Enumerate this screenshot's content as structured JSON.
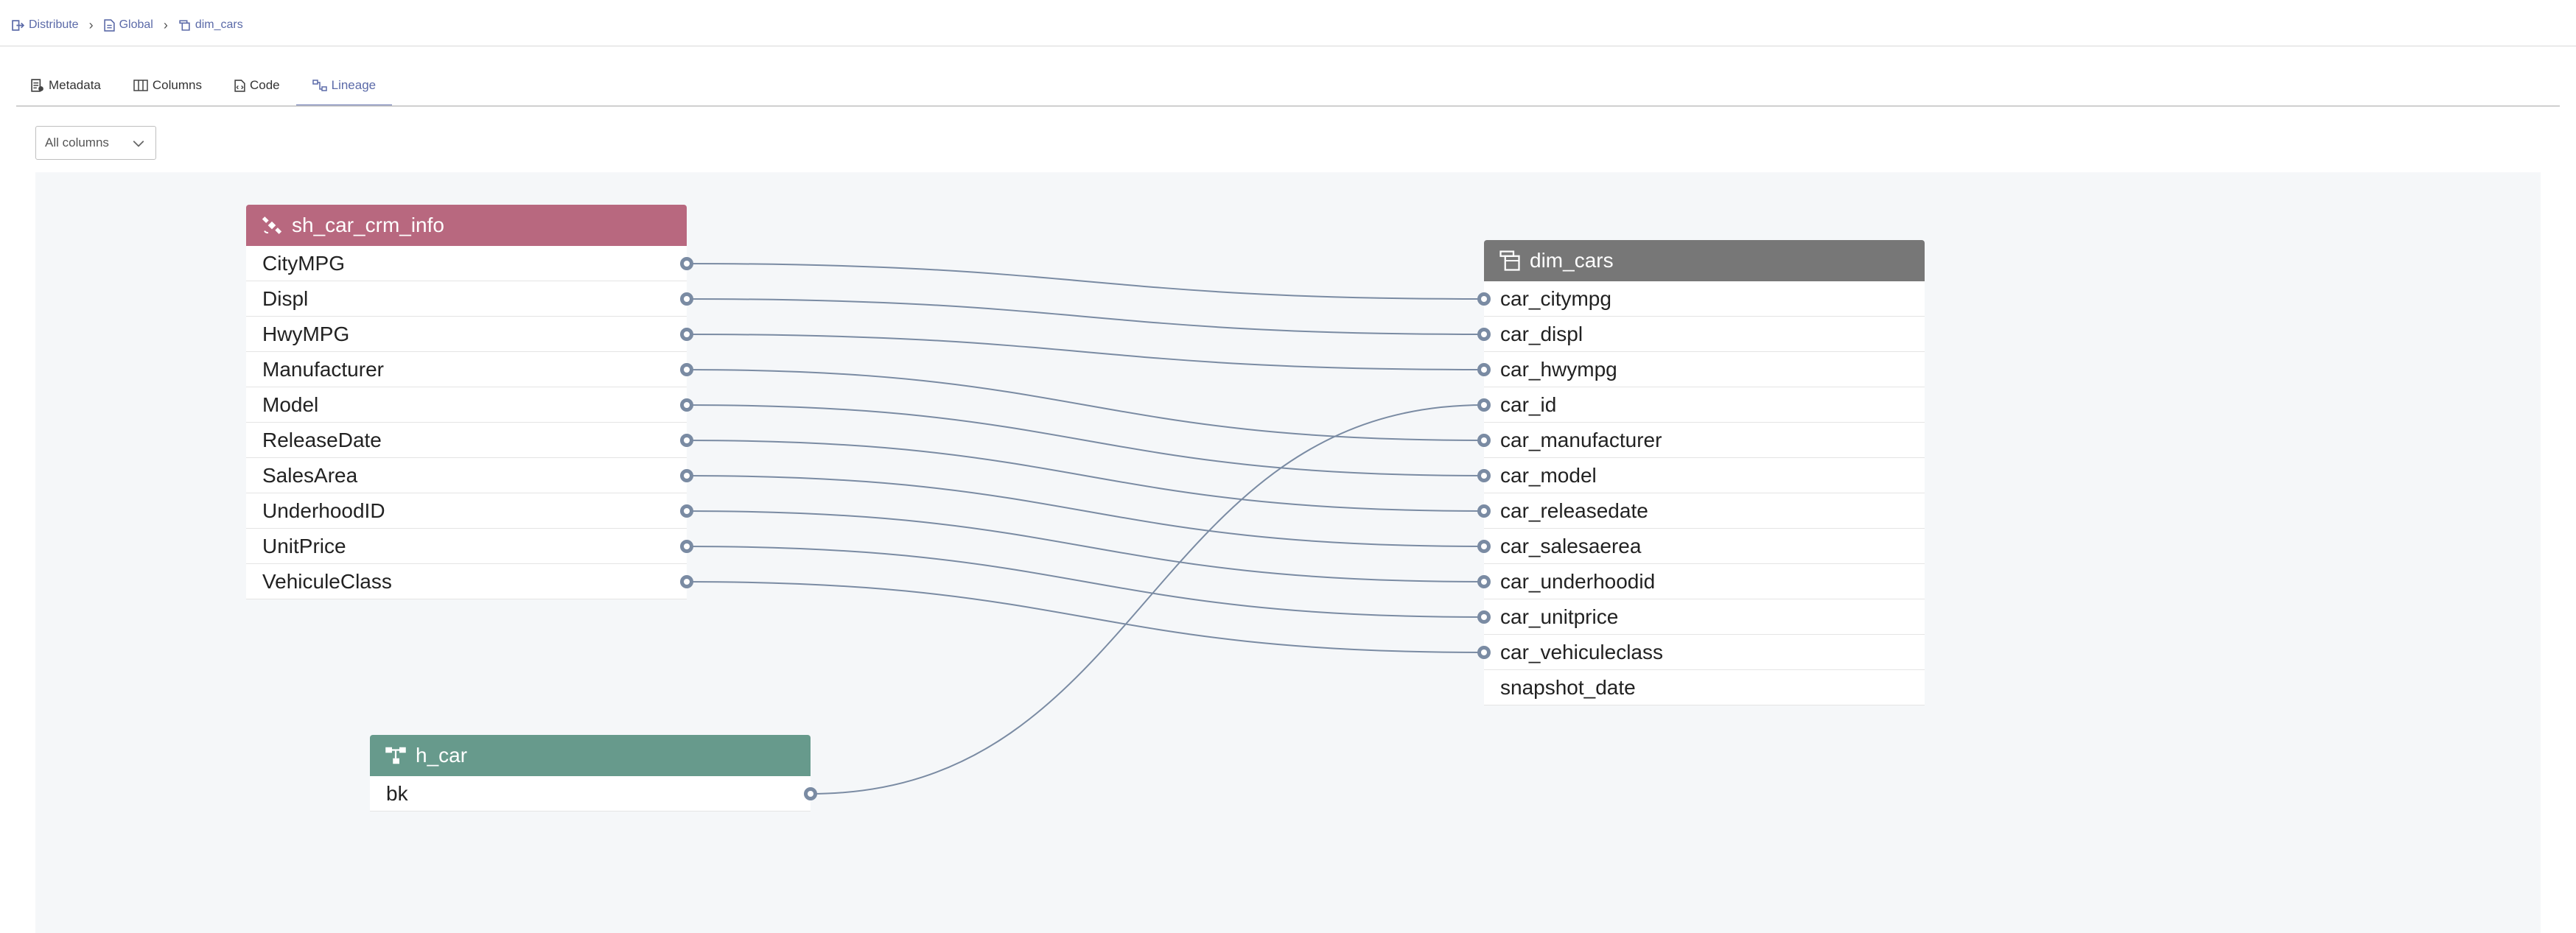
{
  "breadcrumb": [
    {
      "label": "Distribute",
      "icon": "distribute-icon"
    },
    {
      "label": "Global",
      "icon": "document-icon"
    },
    {
      "label": "dim_cars",
      "icon": "table-icon"
    }
  ],
  "tabs": [
    {
      "label": "Metadata",
      "icon": "metadata-icon",
      "active": false
    },
    {
      "label": "Columns",
      "icon": "columns-icon",
      "active": false
    },
    {
      "label": "Code",
      "icon": "code-icon",
      "active": false
    },
    {
      "label": "Lineage",
      "icon": "lineage-icon",
      "active": true
    }
  ],
  "column_filter": {
    "value": "All columns"
  },
  "nodes": {
    "source": {
      "title": "sh_car_crm_info",
      "icon": "satellite-icon",
      "color": "#b8687f",
      "columns": [
        "CityMPG",
        "Displ",
        "HwyMPG",
        "Manufacturer",
        "Model",
        "ReleaseDate",
        "SalesArea",
        "UnderhoodID",
        "UnitPrice",
        "VehiculeClass"
      ]
    },
    "hub": {
      "title": "h_car",
      "icon": "hub-icon",
      "color": "#679a8c",
      "columns": [
        "bk"
      ]
    },
    "target": {
      "title": "dim_cars",
      "icon": "dimension-icon",
      "color": "#777777",
      "columns": [
        "car_citympg",
        "car_displ",
        "car_hwympg",
        "car_id",
        "car_manufacturer",
        "car_model",
        "car_releasedate",
        "car_salesaerea",
        "car_underhoodid",
        "car_unitprice",
        "car_vehiculeclass",
        "snapshot_date"
      ]
    }
  },
  "links": [
    {
      "from": "sh_car_crm_info.CityMPG",
      "to": "dim_cars.car_citympg"
    },
    {
      "from": "sh_car_crm_info.Displ",
      "to": "dim_cars.car_displ"
    },
    {
      "from": "sh_car_crm_info.HwyMPG",
      "to": "dim_cars.car_hwympg"
    },
    {
      "from": "sh_car_crm_info.Manufacturer",
      "to": "dim_cars.car_manufacturer"
    },
    {
      "from": "sh_car_crm_info.Model",
      "to": "dim_cars.car_model"
    },
    {
      "from": "sh_car_crm_info.ReleaseDate",
      "to": "dim_cars.car_releasedate"
    },
    {
      "from": "sh_car_crm_info.SalesArea",
      "to": "dim_cars.car_salesaerea"
    },
    {
      "from": "sh_car_crm_info.UnderhoodID",
      "to": "dim_cars.car_underhoodid"
    },
    {
      "from": "sh_car_crm_info.UnitPrice",
      "to": "dim_cars.car_unitprice"
    },
    {
      "from": "sh_car_crm_info.VehiculeClass",
      "to": "dim_cars.car_vehiculeclass"
    },
    {
      "from": "h_car.bk",
      "to": "dim_cars.car_id"
    }
  ],
  "link_color": "#7a8ba3"
}
